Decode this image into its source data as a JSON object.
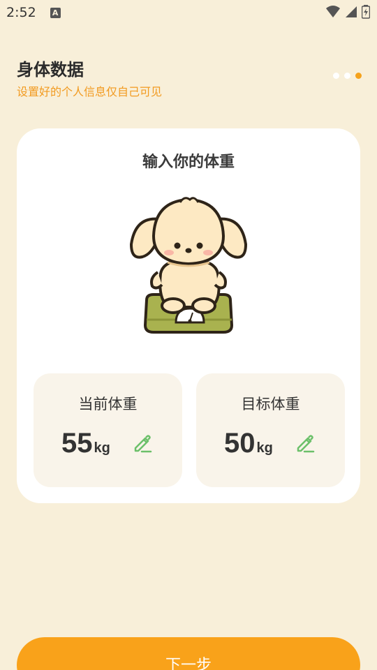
{
  "status_bar": {
    "time": "2:52",
    "notification_icon": "A"
  },
  "header": {
    "title": "身体数据",
    "subtitle": "设置好的个人信息仅自己可见",
    "step_current": 3,
    "step_total": 3
  },
  "card": {
    "title": "输入你的体重",
    "illustration": "puppy-on-scale"
  },
  "current_weight": {
    "label": "当前体重",
    "value": "55",
    "unit": "kg"
  },
  "target_weight": {
    "label": "目标体重",
    "value": "50",
    "unit": "kg"
  },
  "next_button": {
    "label": "下一步"
  },
  "colors": {
    "background": "#f8efd9",
    "accent": "#f9a21a",
    "subtitle": "#f29a1f",
    "edit_icon": "#6cc06a",
    "card": "#ffffff",
    "weight_box": "#f9f4ea"
  }
}
